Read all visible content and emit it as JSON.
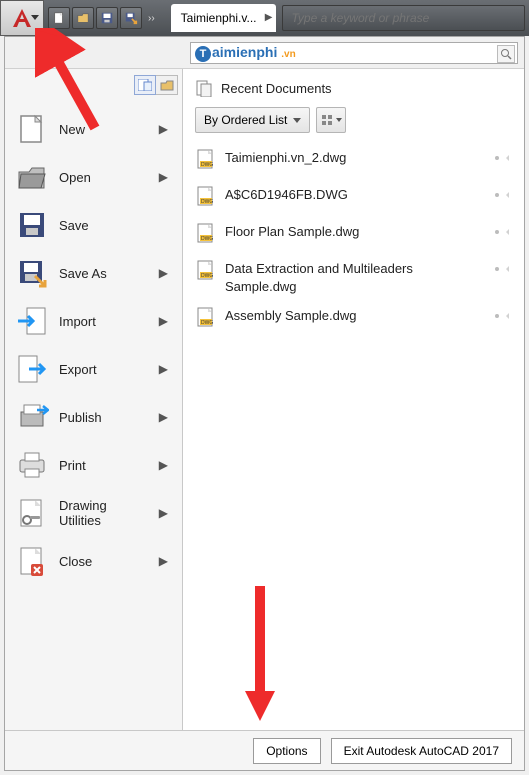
{
  "titlebar": {
    "tab_label": "Taimienphi.v...",
    "search_placeholder": "Type a keyword or phrase"
  },
  "panel_search": {
    "watermark_text": "aimienphi",
    "watermark_suffix": ".vn"
  },
  "menu": {
    "new": "New",
    "open": "Open",
    "save": "Save",
    "save_as": "Save As",
    "import": "Import",
    "export": "Export",
    "publish": "Publish",
    "print": "Print",
    "drawing_utilities": "Drawing\nUtilities",
    "close": "Close"
  },
  "recent": {
    "heading": "Recent Documents",
    "sort_label": "By Ordered List",
    "docs": [
      {
        "name": "Taimienphi.vn_2.dwg"
      },
      {
        "name": "A$C6D1946FB.DWG"
      },
      {
        "name": "Floor Plan Sample.dwg"
      },
      {
        "name": "Data Extraction and Multileaders Sample.dwg"
      },
      {
        "name": "Assembly Sample.dwg"
      }
    ]
  },
  "footer": {
    "options": "Options",
    "exit": "Exit Autodesk AutoCAD 2017"
  }
}
